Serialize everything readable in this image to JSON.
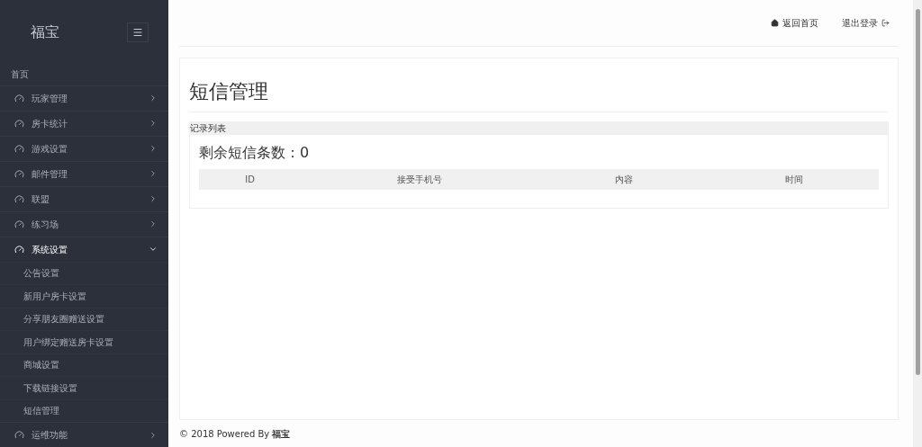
{
  "sidebar": {
    "brand": "福宝",
    "home": "首页",
    "items": [
      {
        "label": "玩家管理",
        "expanded": false
      },
      {
        "label": "房卡统计",
        "expanded": false
      },
      {
        "label": "游戏设置",
        "expanded": false
      },
      {
        "label": "邮件管理",
        "expanded": false
      },
      {
        "label": "联盟",
        "expanded": false
      },
      {
        "label": "练习场",
        "expanded": false
      },
      {
        "label": "系统设置",
        "expanded": true,
        "children": [
          {
            "label": "公告设置"
          },
          {
            "label": "新用户房卡设置"
          },
          {
            "label": "分享朋友圈赠送设置"
          },
          {
            "label": "用户绑定赠送房卡设置"
          },
          {
            "label": "商城设置"
          },
          {
            "label": "下载链接设置"
          },
          {
            "label": "短信管理"
          }
        ]
      },
      {
        "label": "运维功能",
        "expanded": false
      }
    ]
  },
  "header": {
    "links": [
      {
        "label": "返回首页",
        "kind": "home"
      },
      {
        "label": "退出登录",
        "kind": "logout"
      }
    ]
  },
  "page": {
    "title": "短信管理",
    "panel_title": "记录列表",
    "remaining": "剩余短信条数：0",
    "table": {
      "columns": [
        "ID",
        "接受手机号",
        "内容",
        "时间"
      ]
    }
  },
  "footer": "© 2018 Powered By **福宝**"
}
